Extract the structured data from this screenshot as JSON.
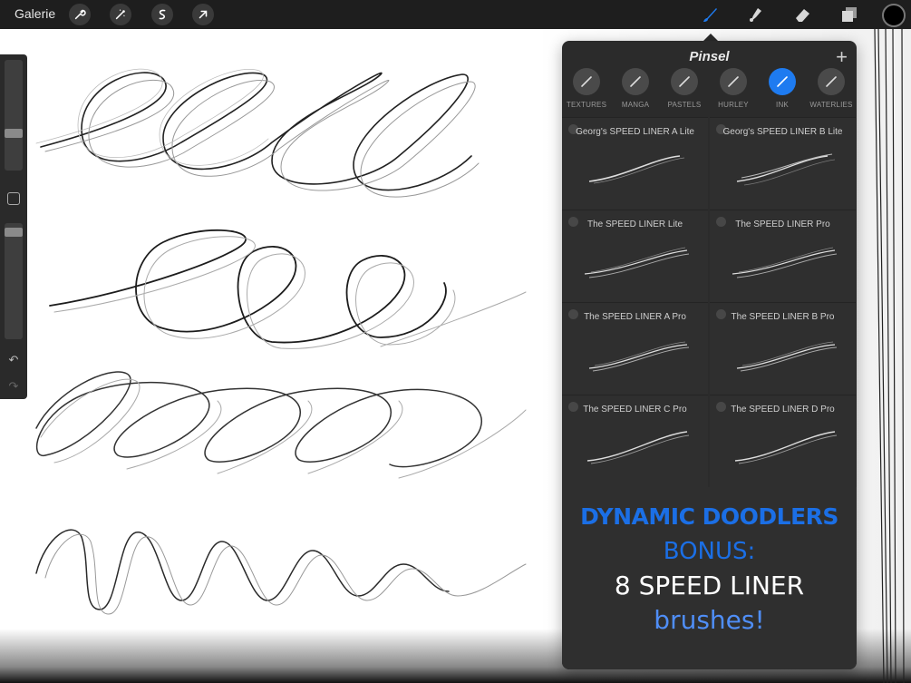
{
  "topbar": {
    "gallery_label": "Galerie"
  },
  "panel": {
    "title": "Pinsel",
    "add_icon": "plus-icon",
    "sets": [
      {
        "label": "TEXTURES",
        "active": false
      },
      {
        "label": "MANGA",
        "active": false
      },
      {
        "label": "PASTELS",
        "active": false
      },
      {
        "label": "HURLEY",
        "active": false
      },
      {
        "label": "INK",
        "active": true
      },
      {
        "label": "WATERLIES",
        "active": false
      }
    ],
    "brushes": [
      "Georg's SPEED LINER A Lite",
      "Georg's SPEED LINER B Lite",
      "The SPEED LINER Lite",
      "The SPEED LINER Pro",
      "The SPEED LINER A Pro",
      "The SPEED LINER B Pro",
      "The SPEED LINER C Pro",
      "The SPEED LINER D Pro"
    ],
    "promo": {
      "line1": "DYNAMIC DOODLERS",
      "line2": "BONUS:",
      "line3": "8 SPEED LINER",
      "line4": "brushes!"
    }
  },
  "colors": {
    "accent": "#1e7bf0",
    "panel_bg": "#2b2b2b",
    "topbar_bg": "#1e1e1e",
    "current_color": "#000000"
  },
  "sidebar": {
    "brush_size": 0.32,
    "opacity": 0.96
  }
}
